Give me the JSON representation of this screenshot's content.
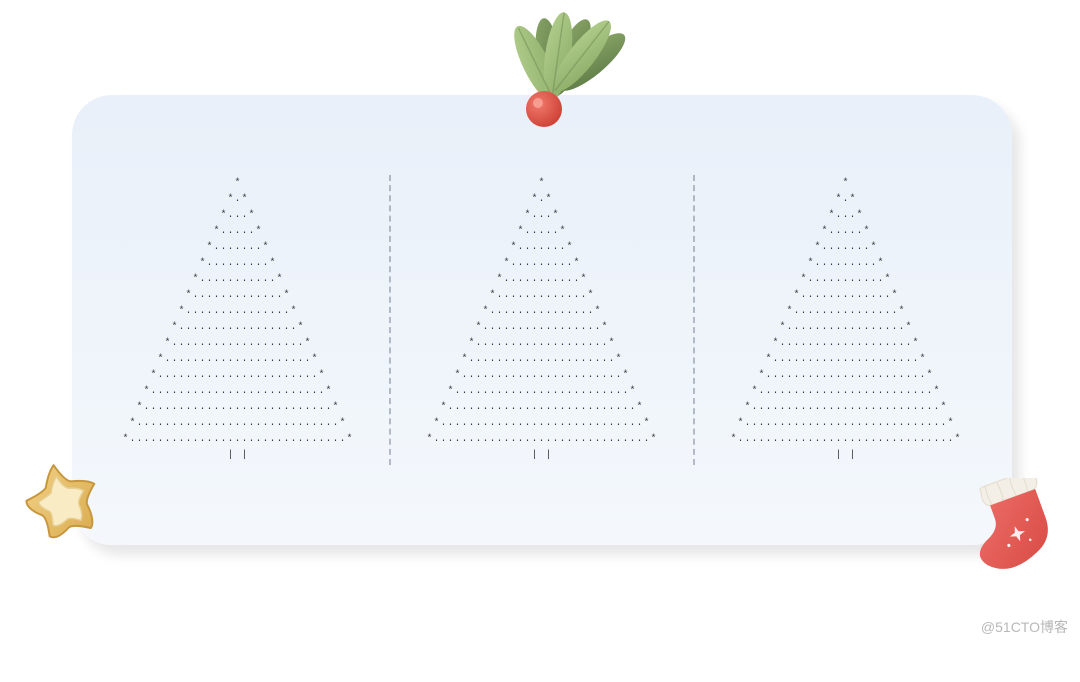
{
  "trees": [
    {
      "lines": [
        "*",
        "*.*",
        "*...*",
        "*.....*",
        "*.......*",
        "*.........*",
        "*...........*",
        "*.............*",
        "*...............*",
        "*.................*",
        "*...................*",
        "*.....................*",
        "*.......................*",
        "*.........................*",
        "*...........................*",
        "*.............................*",
        "*...............................*",
        "| |"
      ]
    },
    {
      "lines": [
        "*",
        "*.*",
        "*...*",
        "*.....*",
        "*.......*",
        "*.........*",
        "*...........*",
        "*.............*",
        "*...............*",
        "*.................*",
        "*...................*",
        "*.....................*",
        "*.......................*",
        "*.........................*",
        "*...........................*",
        "*.............................*",
        "*...............................*",
        "| |"
      ]
    },
    {
      "lines": [
        "*",
        "*.*",
        "*...*",
        "*.....*",
        "*.......*",
        "*.........*",
        "*...........*",
        "*.............*",
        "*...............*",
        "*.................*",
        "*...................*",
        "*.....................*",
        "*.......................*",
        "*.........................*",
        "*...........................*",
        "*.............................*",
        "*...............................*",
        "| |"
      ]
    }
  ],
  "watermark": "@51CTO博客",
  "decorations": {
    "top": "holly-leaves-berry",
    "bottom_left": "star-cookie",
    "bottom_right": "christmas-stocking"
  },
  "colors": {
    "card_bg_top": "#e9f0f9",
    "card_bg_bottom": "#f4f8fc",
    "tree_text": "#3a3a3a",
    "divider": "#7d8a9a",
    "holly_leaf_light": "#9db87a",
    "holly_leaf_dark": "#6d8b55",
    "holly_berry": "#e04b3f",
    "star_cookie": "#e8c267",
    "star_cookie_inner": "#f7e7b8",
    "stocking_body": "#e45a55",
    "stocking_cuff": "#f3eee6"
  }
}
